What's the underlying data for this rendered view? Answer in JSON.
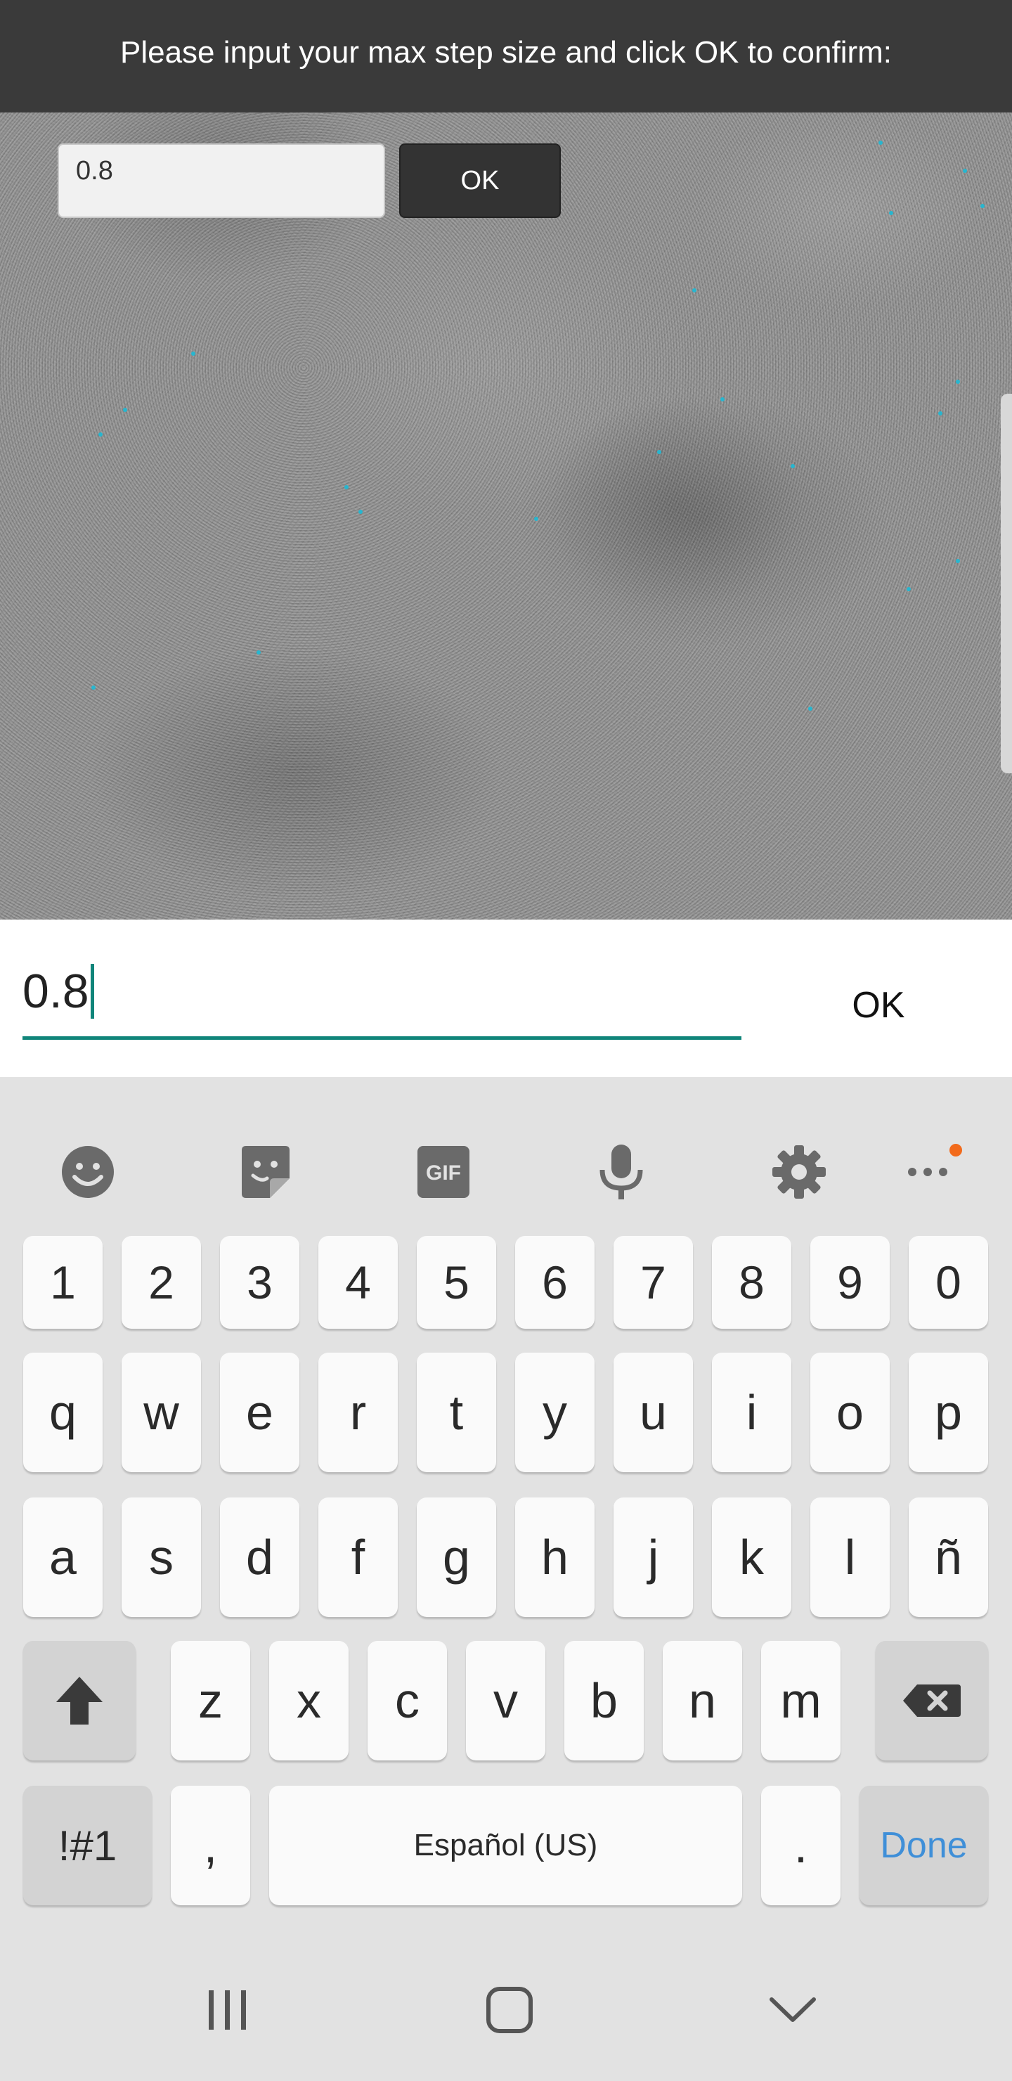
{
  "dialog": {
    "prompt": "Please input your max step size and click OK to confirm:",
    "input_value": "0.8",
    "ok_label": "OK"
  },
  "input_row": {
    "value": "0.8",
    "ok_label": "OK"
  },
  "keyboard": {
    "toolbar_icons": [
      "emoji-icon",
      "sticker-icon",
      "gif-icon",
      "microphone-icon",
      "settings-gear-icon",
      "more-options-icon"
    ],
    "gif_label": "GIF",
    "number_row": [
      "1",
      "2",
      "3",
      "4",
      "5",
      "6",
      "7",
      "8",
      "9",
      "0"
    ],
    "row1": [
      "q",
      "w",
      "e",
      "r",
      "t",
      "y",
      "u",
      "i",
      "o",
      "p"
    ],
    "row2": [
      "a",
      "s",
      "d",
      "f",
      "g",
      "h",
      "j",
      "k",
      "l",
      "ñ"
    ],
    "row3": [
      "z",
      "x",
      "c",
      "v",
      "b",
      "n",
      "m"
    ],
    "symbols_label": "!#1",
    "comma_label": ",",
    "space_label": "Español (US)",
    "period_label": ".",
    "done_label": "Done",
    "accent_color": "#10857a",
    "done_color": "#3f8fd8",
    "notification_dot_color": "#f26a1b"
  },
  "navbar": {
    "icons": [
      "recent-apps-icon",
      "home-icon",
      "back-chevron-icon"
    ]
  }
}
